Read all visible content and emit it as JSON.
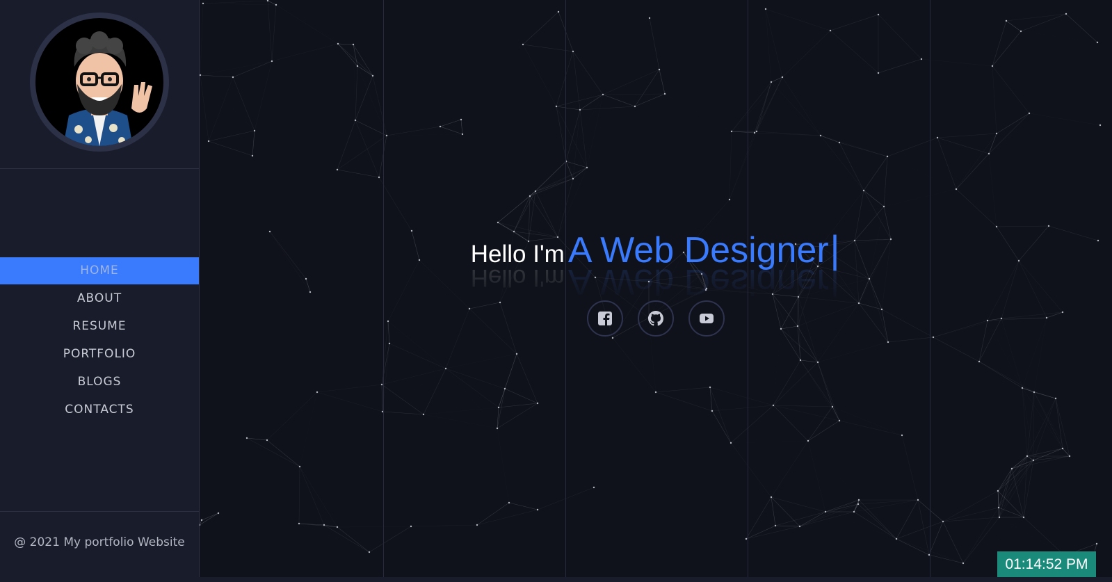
{
  "sidebar": {
    "nav": [
      {
        "label": "HOME",
        "active": true
      },
      {
        "label": "ABOUT",
        "active": false
      },
      {
        "label": "RESUME",
        "active": false
      },
      {
        "label": "PORTFOLIO",
        "active": false
      },
      {
        "label": "BLOGS",
        "active": false
      },
      {
        "label": "CONTACTS",
        "active": false
      }
    ],
    "footer": "@ 2021 My portfolio Website"
  },
  "hero": {
    "greeting": "Hello I'm",
    "role": "A Web Designer",
    "cursor": "|"
  },
  "social": [
    "facebook-icon",
    "github-icon",
    "youtube-icon"
  ],
  "clock": "01:14:52 PM",
  "colors": {
    "accent": "#3a7bfd",
    "sidebar_bg": "#191c2a",
    "main_bg": "#10121b",
    "clock_bg": "#1a8a7a"
  }
}
